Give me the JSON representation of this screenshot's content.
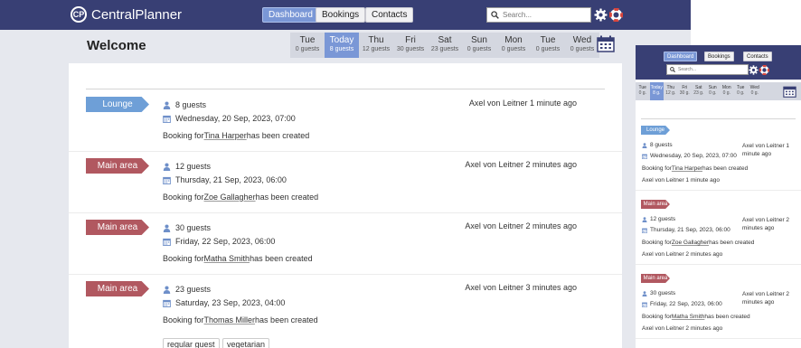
{
  "app": {
    "name": "CentralPlanner",
    "logo_mark": "CP"
  },
  "nav": {
    "dashboard": "Dashboard",
    "bookings": "Bookings",
    "contacts": "Contacts"
  },
  "search": {
    "placeholder": "Search..."
  },
  "icons": {
    "settings": "gear-icon",
    "help": "lifebuoy-icon",
    "calendar": "calendar-icon",
    "guests": "person-icon",
    "date": "calendar-small-icon",
    "search": "search-icon"
  },
  "colors": {
    "header": "#383f74",
    "active": "#7a97d6",
    "lounge": "#6e9fd7",
    "main_area": "#b15860"
  },
  "page": {
    "title": "Welcome"
  },
  "days": [
    {
      "name": "Tue",
      "guests": "0 guests",
      "today": false
    },
    {
      "name": "Today",
      "guests": "8 guests",
      "today": true
    },
    {
      "name": "Thu",
      "guests": "12 guests",
      "today": false
    },
    {
      "name": "Fri",
      "guests": "30 guests",
      "today": false
    },
    {
      "name": "Sat",
      "guests": "23 guests",
      "today": false
    },
    {
      "name": "Sun",
      "guests": "0 guests",
      "today": false
    },
    {
      "name": "Mon",
      "guests": "0 guests",
      "today": false
    },
    {
      "name": "Tue",
      "guests": "0 guests",
      "today": false
    },
    {
      "name": "Wed",
      "guests": "0 guests",
      "today": false
    }
  ],
  "bookings": [
    {
      "area": "Lounge",
      "guests": "8 guests",
      "date": "Wednesday, 20 Sep, 2023, 07:00",
      "text_pre": "Booking for ",
      "person": "Tina Harper",
      "text_post": " has been created",
      "meta": "Axel von Leitner 1 minute ago",
      "tags": []
    },
    {
      "area": "Main area",
      "guests": "12 guests",
      "date": "Thursday, 21 Sep, 2023, 06:00",
      "text_pre": "Booking for ",
      "person": "Zoe Gallagher",
      "text_post": " has been created",
      "meta": "Axel von Leitner 2 minutes ago",
      "tags": []
    },
    {
      "area": "Main area",
      "guests": "30 guests",
      "date": "Friday, 22 Sep, 2023, 06:00",
      "text_pre": "Booking for ",
      "person": "Matha Smith",
      "text_post": " has been created",
      "meta": "Axel von Leitner 2 minutes ago",
      "tags": []
    },
    {
      "area": "Main area",
      "guests": "23 guests",
      "date": "Saturday, 23 Sep, 2023, 04:00",
      "text_pre": "Booking for ",
      "person": "Thomas Miller",
      "text_post": " has been created",
      "meta": "Axel von Leitner 3 minutes ago",
      "tags": [
        "regular guest",
        "vegetarian"
      ]
    }
  ],
  "mobile": {
    "days": [
      {
        "name": "Tue",
        "guests": "0 g."
      },
      {
        "name": "Today",
        "guests": "8 g."
      },
      {
        "name": "Thu",
        "guests": "12 g."
      },
      {
        "name": "Fri",
        "guests": "30 g."
      },
      {
        "name": "Sat",
        "guests": "23 g."
      },
      {
        "name": "Sun",
        "guests": "0 g."
      },
      {
        "name": "Mon",
        "guests": "0 g."
      },
      {
        "name": "Tue",
        "guests": "0 g."
      },
      {
        "name": "Wed",
        "guests": "0 g."
      }
    ],
    "meta": [
      "Axel von Leitner 1 minute ago",
      "Axel von Leitner 2 minutes ago",
      "Axel von Leitner 2 minutes ago"
    ]
  }
}
